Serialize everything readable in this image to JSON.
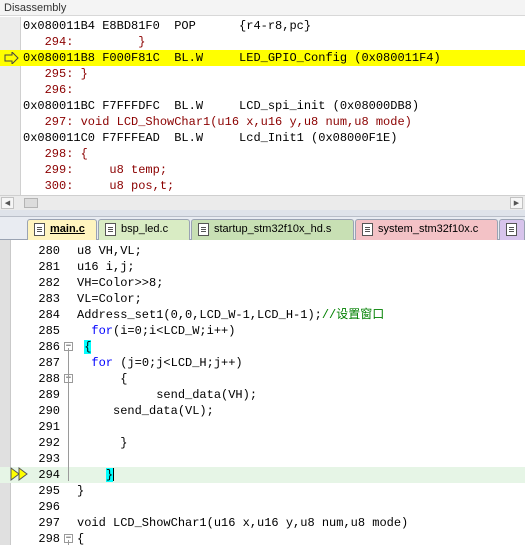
{
  "disassembly": {
    "title": "Disassembly",
    "rows": [
      {
        "text": "0x080011B4 E8BD81F0  POP      {r4-r8,pc}",
        "type": "asm",
        "highlight": false
      },
      {
        "text": "   294:         }",
        "type": "src",
        "highlight": false
      },
      {
        "text": "0x080011B8 F000F81C  BL.W     LED_GPIO_Config (0x080011F4)",
        "type": "asm",
        "highlight": true
      },
      {
        "text": "   295: }",
        "type": "src",
        "highlight": false
      },
      {
        "text": "   296:",
        "type": "src",
        "highlight": false
      },
      {
        "text": "0x080011BC F7FFFDFC  BL.W     LCD_spi_init (0x08000DB8)",
        "type": "asm",
        "highlight": false
      },
      {
        "text": "   297: void LCD_ShowChar1(u16 x,u16 y,u8 num,u8 mode)",
        "type": "src",
        "highlight": false
      },
      {
        "text": "0x080011C0 F7FFFEAD  BL.W     Lcd_Init1 (0x08000F1E)",
        "type": "asm",
        "highlight": false
      },
      {
        "text": "   298: {",
        "type": "src",
        "highlight": false
      },
      {
        "text": "   299:     u8 temp;",
        "type": "src",
        "highlight": false
      },
      {
        "text": "   300:     u8 pos,t;",
        "type": "src",
        "highlight": false
      }
    ],
    "current_arrow_icon": "yellow-arrow-icon"
  },
  "tabs": [
    {
      "label": "main.c",
      "active": true
    },
    {
      "label": "bsp_led.c",
      "active": false,
      "color": "#d9ecc4"
    },
    {
      "label": "startup_stm32f10x_hd.s",
      "active": false,
      "color": "#c8e0b4"
    },
    {
      "label": "system_stm32f10x.c",
      "active": false,
      "color": "#f3c2c6"
    },
    {
      "label": "",
      "active": false,
      "color": "#d8c4ec"
    }
  ],
  "editor": {
    "lines": [
      {
        "num": "280",
        "segments": [
          {
            "t": "u8 VH,VL;",
            "c": "plain"
          }
        ]
      },
      {
        "num": "281",
        "segments": [
          {
            "t": "u16 i,j;",
            "c": "plain"
          }
        ]
      },
      {
        "num": "282",
        "segments": [
          {
            "t": "VH=Color>>8;",
            "c": "plain"
          }
        ]
      },
      {
        "num": "283",
        "segments": [
          {
            "t": "VL=Color;",
            "c": "plain"
          }
        ]
      },
      {
        "num": "284",
        "segments": [
          {
            "t": "Address_set1(0,0,LCD_W-1,LCD_H-1);",
            "c": "plain"
          },
          {
            "t": "//设置窗口",
            "c": "comment"
          }
        ]
      },
      {
        "num": "285",
        "segments": [
          {
            "t": "  ",
            "c": "plain"
          },
          {
            "t": "for",
            "c": "kw"
          },
          {
            "t": "(i=0;i<LCD_W;i++)",
            "c": "plain"
          }
        ]
      },
      {
        "num": "286",
        "segments": [
          {
            "t": " ",
            "c": "plain"
          },
          {
            "t": "{",
            "c": "brace"
          }
        ]
      },
      {
        "num": "287",
        "segments": [
          {
            "t": "  ",
            "c": "plain"
          },
          {
            "t": "for",
            "c": "kw"
          },
          {
            "t": " (j=0;j<LCD_H;j++)",
            "c": "plain"
          }
        ]
      },
      {
        "num": "288",
        "segments": [
          {
            "t": "      {",
            "c": "plain"
          }
        ]
      },
      {
        "num": "289",
        "segments": [
          {
            "t": "           send_data(VH);",
            "c": "plain"
          }
        ]
      },
      {
        "num": "290",
        "segments": [
          {
            "t": "     send_data(VL);",
            "c": "plain"
          }
        ]
      },
      {
        "num": "291",
        "segments": [
          {
            "t": "",
            "c": "plain"
          }
        ]
      },
      {
        "num": "292",
        "segments": [
          {
            "t": "      }",
            "c": "plain"
          }
        ]
      },
      {
        "num": "293",
        "segments": [
          {
            "t": "",
            "c": "plain"
          }
        ]
      },
      {
        "num": "294",
        "segments": [
          {
            "t": "    ",
            "c": "plain"
          },
          {
            "t": "}",
            "c": "brace"
          },
          {
            "t": "",
            "c": "cursor"
          }
        ]
      },
      {
        "num": "295",
        "segments": [
          {
            "t": "}",
            "c": "plain"
          }
        ]
      },
      {
        "num": "296",
        "segments": [
          {
            "t": "",
            "c": "plain"
          }
        ]
      },
      {
        "num": "297",
        "segments": [
          {
            "t": "void LCD_ShowChar1(u16 x,u16 y,u8 num,u8 mode)",
            "c": "plain"
          }
        ]
      },
      {
        "num": "298",
        "segments": [
          {
            "t": "{",
            "c": "plain"
          }
        ]
      }
    ],
    "current_line": "294",
    "fold_minus_lines": [
      "286",
      "288",
      "298"
    ],
    "exec_arrow_icon": "double-yellow-arrow-icon"
  }
}
